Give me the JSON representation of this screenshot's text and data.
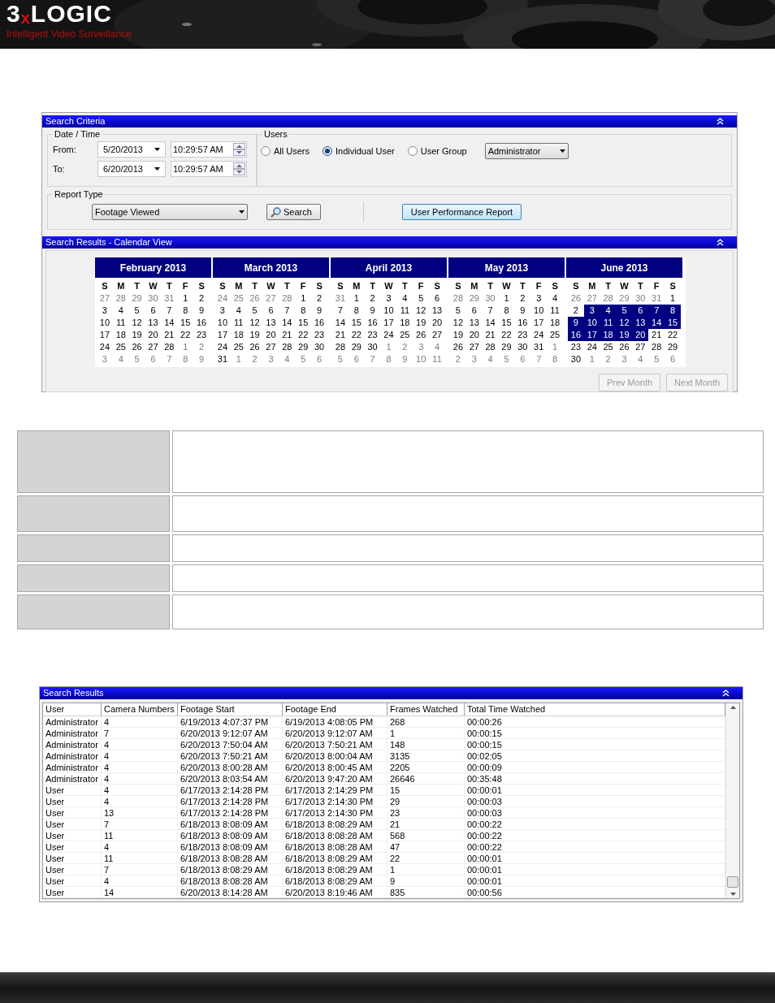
{
  "header": {
    "logo": [
      {
        "text": "3",
        "color": "#ffffff"
      },
      {
        "text": "x",
        "color": "#d01010"
      },
      {
        "text": "LOGIC",
        "color": "#ffffff"
      }
    ],
    "tagline": "Intelligent Video Surveillance"
  },
  "search_criteria": {
    "title": "Search Criteria",
    "date_time": {
      "legend": "Date / Time",
      "rows": [
        {
          "label": "From:",
          "date": "5/20/2013",
          "time": "10:29:57 AM"
        },
        {
          "label": "To:",
          "date": "6/20/2013",
          "time": "10:29:57 AM"
        }
      ]
    },
    "users": {
      "legend": "Users",
      "options": [
        {
          "label": "All Users",
          "selected": false
        },
        {
          "label": "Individual User",
          "selected": true
        },
        {
          "label": "User Group",
          "selected": false
        }
      ],
      "user_select": "Administrator"
    },
    "report_type": {
      "legend": "Report Type",
      "value": "Footage Viewed"
    },
    "search_button": "Search",
    "report_button": "User Performance Report"
  },
  "calendar_view": {
    "title": "Search Results - Calendar View",
    "months": [
      {
        "title": "February 2013",
        "weekdays": [
          "S",
          "M",
          "T",
          "W",
          "T",
          "F",
          "S"
        ],
        "weeks": [
          [
            {
              "day": "27",
              "muted": true,
              "selected": false
            },
            {
              "day": "28",
              "muted": true,
              "selected": false
            },
            {
              "day": "29",
              "muted": true,
              "selected": false
            },
            {
              "day": "30",
              "muted": true,
              "selected": false
            },
            {
              "day": "31",
              "muted": true,
              "selected": false
            },
            {
              "day": "1",
              "muted": false,
              "selected": false
            },
            {
              "day": "2",
              "muted": false,
              "selected": false
            }
          ],
          [
            {
              "day": "3",
              "muted": false,
              "selected": false
            },
            {
              "day": "4",
              "muted": false,
              "selected": false
            },
            {
              "day": "5",
              "muted": false,
              "selected": false
            },
            {
              "day": "6",
              "muted": false,
              "selected": false
            },
            {
              "day": "7",
              "muted": false,
              "selected": false
            },
            {
              "day": "8",
              "muted": false,
              "selected": false
            },
            {
              "day": "9",
              "muted": false,
              "selected": false
            }
          ],
          [
            {
              "day": "10",
              "muted": false,
              "selected": false
            },
            {
              "day": "11",
              "muted": false,
              "selected": false
            },
            {
              "day": "12",
              "muted": false,
              "selected": false
            },
            {
              "day": "13",
              "muted": false,
              "selected": false
            },
            {
              "day": "14",
              "muted": false,
              "selected": false
            },
            {
              "day": "15",
              "muted": false,
              "selected": false
            },
            {
              "day": "16",
              "muted": false,
              "selected": false
            }
          ],
          [
            {
              "day": "17",
              "muted": false,
              "selected": false
            },
            {
              "day": "18",
              "muted": false,
              "selected": false
            },
            {
              "day": "19",
              "muted": false,
              "selected": false
            },
            {
              "day": "20",
              "muted": false,
              "selected": false
            },
            {
              "day": "21",
              "muted": false,
              "selected": false
            },
            {
              "day": "22",
              "muted": false,
              "selected": false
            },
            {
              "day": "23",
              "muted": false,
              "selected": false
            }
          ],
          [
            {
              "day": "24",
              "muted": false,
              "selected": false
            },
            {
              "day": "25",
              "muted": false,
              "selected": false
            },
            {
              "day": "26",
              "muted": false,
              "selected": false
            },
            {
              "day": "27",
              "muted": false,
              "selected": false
            },
            {
              "day": "28",
              "muted": false,
              "selected": false
            },
            {
              "day": "1",
              "muted": true,
              "selected": false
            },
            {
              "day": "2",
              "muted": true,
              "selected": false
            }
          ],
          [
            {
              "day": "3",
              "muted": true,
              "selected": false
            },
            {
              "day": "4",
              "muted": true,
              "selected": false
            },
            {
              "day": "5",
              "muted": true,
              "selected": false
            },
            {
              "day": "6",
              "muted": true,
              "selected": false
            },
            {
              "day": "7",
              "muted": true,
              "selected": false
            },
            {
              "day": "8",
              "muted": true,
              "selected": false
            },
            {
              "day": "9",
              "muted": true,
              "selected": false
            }
          ]
        ]
      },
      {
        "title": "March 2013",
        "weekdays": [
          "S",
          "M",
          "T",
          "W",
          "T",
          "F",
          "S"
        ],
        "weeks": [
          [
            {
              "day": "24",
              "muted": true,
              "selected": false
            },
            {
              "day": "25",
              "muted": true,
              "selected": false
            },
            {
              "day": "26",
              "muted": true,
              "selected": false
            },
            {
              "day": "27",
              "muted": true,
              "selected": false
            },
            {
              "day": "28",
              "muted": true,
              "selected": false
            },
            {
              "day": "1",
              "muted": false,
              "selected": false
            },
            {
              "day": "2",
              "muted": false,
              "selected": false
            }
          ],
          [
            {
              "day": "3",
              "muted": false,
              "selected": false
            },
            {
              "day": "4",
              "muted": false,
              "selected": false
            },
            {
              "day": "5",
              "muted": false,
              "selected": false
            },
            {
              "day": "6",
              "muted": false,
              "selected": false
            },
            {
              "day": "7",
              "muted": false,
              "selected": false
            },
            {
              "day": "8",
              "muted": false,
              "selected": false
            },
            {
              "day": "9",
              "muted": false,
              "selected": false
            }
          ],
          [
            {
              "day": "10",
              "muted": false,
              "selected": false
            },
            {
              "day": "11",
              "muted": false,
              "selected": false
            },
            {
              "day": "12",
              "muted": false,
              "selected": false
            },
            {
              "day": "13",
              "muted": false,
              "selected": false
            },
            {
              "day": "14",
              "muted": false,
              "selected": false
            },
            {
              "day": "15",
              "muted": false,
              "selected": false
            },
            {
              "day": "16",
              "muted": false,
              "selected": false
            }
          ],
          [
            {
              "day": "17",
              "muted": false,
              "selected": false
            },
            {
              "day": "18",
              "muted": false,
              "selected": false
            },
            {
              "day": "19",
              "muted": false,
              "selected": false
            },
            {
              "day": "20",
              "muted": false,
              "selected": false
            },
            {
              "day": "21",
              "muted": false,
              "selected": false
            },
            {
              "day": "22",
              "muted": false,
              "selected": false
            },
            {
              "day": "23",
              "muted": false,
              "selected": false
            }
          ],
          [
            {
              "day": "24",
              "muted": false,
              "selected": false
            },
            {
              "day": "25",
              "muted": false,
              "selected": false
            },
            {
              "day": "26",
              "muted": false,
              "selected": false
            },
            {
              "day": "27",
              "muted": false,
              "selected": false
            },
            {
              "day": "28",
              "muted": false,
              "selected": false
            },
            {
              "day": "29",
              "muted": false,
              "selected": false
            },
            {
              "day": "30",
              "muted": false,
              "selected": false
            }
          ],
          [
            {
              "day": "31",
              "muted": false,
              "selected": false
            },
            {
              "day": "1",
              "muted": true,
              "selected": false
            },
            {
              "day": "2",
              "muted": true,
              "selected": false
            },
            {
              "day": "3",
              "muted": true,
              "selected": false
            },
            {
              "day": "4",
              "muted": true,
              "selected": false
            },
            {
              "day": "5",
              "muted": true,
              "selected": false
            },
            {
              "day": "6",
              "muted": true,
              "selected": false
            }
          ]
        ]
      },
      {
        "title": "April 2013",
        "weekdays": [
          "S",
          "M",
          "T",
          "W",
          "T",
          "F",
          "S"
        ],
        "weeks": [
          [
            {
              "day": "31",
              "muted": true,
              "selected": false
            },
            {
              "day": "1",
              "muted": false,
              "selected": false
            },
            {
              "day": "2",
              "muted": false,
              "selected": false
            },
            {
              "day": "3",
              "muted": false,
              "selected": false
            },
            {
              "day": "4",
              "muted": false,
              "selected": false
            },
            {
              "day": "5",
              "muted": false,
              "selected": false
            },
            {
              "day": "6",
              "muted": false,
              "selected": false
            }
          ],
          [
            {
              "day": "7",
              "muted": false,
              "selected": false
            },
            {
              "day": "8",
              "muted": false,
              "selected": false
            },
            {
              "day": "9",
              "muted": false,
              "selected": false
            },
            {
              "day": "10",
              "muted": false,
              "selected": false
            },
            {
              "day": "11",
              "muted": false,
              "selected": false
            },
            {
              "day": "12",
              "muted": false,
              "selected": false
            },
            {
              "day": "13",
              "muted": false,
              "selected": false
            }
          ],
          [
            {
              "day": "14",
              "muted": false,
              "selected": false
            },
            {
              "day": "15",
              "muted": false,
              "selected": false
            },
            {
              "day": "16",
              "muted": false,
              "selected": false
            },
            {
              "day": "17",
              "muted": false,
              "selected": false
            },
            {
              "day": "18",
              "muted": false,
              "selected": false
            },
            {
              "day": "19",
              "muted": false,
              "selected": false
            },
            {
              "day": "20",
              "muted": false,
              "selected": false
            }
          ],
          [
            {
              "day": "21",
              "muted": false,
              "selected": false
            },
            {
              "day": "22",
              "muted": false,
              "selected": false
            },
            {
              "day": "23",
              "muted": false,
              "selected": false
            },
            {
              "day": "24",
              "muted": false,
              "selected": false
            },
            {
              "day": "25",
              "muted": false,
              "selected": false
            },
            {
              "day": "26",
              "muted": false,
              "selected": false
            },
            {
              "day": "27",
              "muted": false,
              "selected": false
            }
          ],
          [
            {
              "day": "28",
              "muted": false,
              "selected": false
            },
            {
              "day": "29",
              "muted": false,
              "selected": false
            },
            {
              "day": "30",
              "muted": false,
              "selected": false
            },
            {
              "day": "1",
              "muted": true,
              "selected": false
            },
            {
              "day": "2",
              "muted": true,
              "selected": false
            },
            {
              "day": "3",
              "muted": true,
              "selected": false
            },
            {
              "day": "4",
              "muted": true,
              "selected": false
            }
          ],
          [
            {
              "day": "5",
              "muted": true,
              "selected": false
            },
            {
              "day": "6",
              "muted": true,
              "selected": false
            },
            {
              "day": "7",
              "muted": true,
              "selected": false
            },
            {
              "day": "8",
              "muted": true,
              "selected": false
            },
            {
              "day": "9",
              "muted": true,
              "selected": false
            },
            {
              "day": "10",
              "muted": true,
              "selected": false
            },
            {
              "day": "11",
              "muted": true,
              "selected": false
            }
          ]
        ]
      },
      {
        "title": "May 2013",
        "weekdays": [
          "S",
          "M",
          "T",
          "W",
          "T",
          "F",
          "S"
        ],
        "weeks": [
          [
            {
              "day": "28",
              "muted": true,
              "selected": false
            },
            {
              "day": "29",
              "muted": true,
              "selected": false
            },
            {
              "day": "30",
              "muted": true,
              "selected": false
            },
            {
              "day": "1",
              "muted": false,
              "selected": false
            },
            {
              "day": "2",
              "muted": false,
              "selected": false
            },
            {
              "day": "3",
              "muted": false,
              "selected": false
            },
            {
              "day": "4",
              "muted": false,
              "selected": false
            }
          ],
          [
            {
              "day": "5",
              "muted": false,
              "selected": false
            },
            {
              "day": "6",
              "muted": false,
              "selected": false
            },
            {
              "day": "7",
              "muted": false,
              "selected": false
            },
            {
              "day": "8",
              "muted": false,
              "selected": false
            },
            {
              "day": "9",
              "muted": false,
              "selected": false
            },
            {
              "day": "10",
              "muted": false,
              "selected": false
            },
            {
              "day": "11",
              "muted": false,
              "selected": false
            }
          ],
          [
            {
              "day": "12",
              "muted": false,
              "selected": false
            },
            {
              "day": "13",
              "muted": false,
              "selected": false
            },
            {
              "day": "14",
              "muted": false,
              "selected": false
            },
            {
              "day": "15",
              "muted": false,
              "selected": false
            },
            {
              "day": "16",
              "muted": false,
              "selected": false
            },
            {
              "day": "17",
              "muted": false,
              "selected": false
            },
            {
              "day": "18",
              "muted": false,
              "selected": false
            }
          ],
          [
            {
              "day": "19",
              "muted": false,
              "selected": false
            },
            {
              "day": "20",
              "muted": false,
              "selected": false
            },
            {
              "day": "21",
              "muted": false,
              "selected": false
            },
            {
              "day": "22",
              "muted": false,
              "selected": false
            },
            {
              "day": "23",
              "muted": false,
              "selected": false
            },
            {
              "day": "24",
              "muted": false,
              "selected": false
            },
            {
              "day": "25",
              "muted": false,
              "selected": false
            }
          ],
          [
            {
              "day": "26",
              "muted": false,
              "selected": false
            },
            {
              "day": "27",
              "muted": false,
              "selected": false
            },
            {
              "day": "28",
              "muted": false,
              "selected": false
            },
            {
              "day": "29",
              "muted": false,
              "selected": false
            },
            {
              "day": "30",
              "muted": false,
              "selected": false
            },
            {
              "day": "31",
              "muted": false,
              "selected": false
            },
            {
              "day": "1",
              "muted": true,
              "selected": false
            }
          ],
          [
            {
              "day": "2",
              "muted": true,
              "selected": false
            },
            {
              "day": "3",
              "muted": true,
              "selected": false
            },
            {
              "day": "4",
              "muted": true,
              "selected": false
            },
            {
              "day": "5",
              "muted": true,
              "selected": false
            },
            {
              "day": "6",
              "muted": true,
              "selected": false
            },
            {
              "day": "7",
              "muted": true,
              "selected": false
            },
            {
              "day": "8",
              "muted": true,
              "selected": false
            }
          ]
        ]
      },
      {
        "title": "June 2013",
        "weekdays": [
          "S",
          "M",
          "T",
          "W",
          "T",
          "F",
          "S"
        ],
        "weeks": [
          [
            {
              "day": "26",
              "muted": true,
              "selected": false
            },
            {
              "day": "27",
              "muted": true,
              "selected": false
            },
            {
              "day": "28",
              "muted": true,
              "selected": false
            },
            {
              "day": "29",
              "muted": true,
              "selected": false
            },
            {
              "day": "30",
              "muted": true,
              "selected": false
            },
            {
              "day": "31",
              "muted": true,
              "selected": false
            },
            {
              "day": "1",
              "muted": false,
              "selected": false
            }
          ],
          [
            {
              "day": "2",
              "muted": false,
              "selected": false
            },
            {
              "day": "3",
              "muted": false,
              "selected": true
            },
            {
              "day": "4",
              "muted": false,
              "selected": true
            },
            {
              "day": "5",
              "muted": false,
              "selected": true
            },
            {
              "day": "6",
              "muted": false,
              "selected": true
            },
            {
              "day": "7",
              "muted": false,
              "selected": true
            },
            {
              "day": "8",
              "muted": false,
              "selected": true
            }
          ],
          [
            {
              "day": "9",
              "muted": false,
              "selected": true
            },
            {
              "day": "10",
              "muted": false,
              "selected": true
            },
            {
              "day": "11",
              "muted": false,
              "selected": true
            },
            {
              "day": "12",
              "muted": false,
              "selected": true
            },
            {
              "day": "13",
              "muted": false,
              "selected": true
            },
            {
              "day": "14",
              "muted": false,
              "selected": true
            },
            {
              "day": "15",
              "muted": false,
              "selected": true
            }
          ],
          [
            {
              "day": "16",
              "muted": false,
              "selected": true
            },
            {
              "day": "17",
              "muted": false,
              "selected": true
            },
            {
              "day": "18",
              "muted": false,
              "selected": true
            },
            {
              "day": "19",
              "muted": false,
              "selected": true
            },
            {
              "day": "20",
              "muted": false,
              "selected": true
            },
            {
              "day": "21",
              "muted": false,
              "selected": false
            },
            {
              "day": "22",
              "muted": false,
              "selected": false
            }
          ],
          [
            {
              "day": "23",
              "muted": false,
              "selected": false
            },
            {
              "day": "24",
              "muted": false,
              "selected": false
            },
            {
              "day": "25",
              "muted": false,
              "selected": false
            },
            {
              "day": "26",
              "muted": false,
              "selected": false
            },
            {
              "day": "27",
              "muted": false,
              "selected": false
            },
            {
              "day": "28",
              "muted": false,
              "selected": false
            },
            {
              "day": "29",
              "muted": false,
              "selected": false
            }
          ],
          [
            {
              "day": "30",
              "muted": false,
              "selected": false
            },
            {
              "day": "1",
              "muted": true,
              "selected": false
            },
            {
              "day": "2",
              "muted": true,
              "selected": false
            },
            {
              "day": "3",
              "muted": true,
              "selected": false
            },
            {
              "day": "4",
              "muted": true,
              "selected": false
            },
            {
              "day": "5",
              "muted": true,
              "selected": false
            },
            {
              "day": "6",
              "muted": true,
              "selected": false
            }
          ]
        ]
      }
    ],
    "prev_button": {
      "label": "Prev Month",
      "disabled": true
    },
    "next_button": {
      "label": "Next Month",
      "disabled": true
    }
  },
  "results": {
    "title": "Search Results",
    "columns": [
      "User",
      "Camera Numbers",
      "Footage Start",
      "Footage End",
      "Frames Watched",
      "Total Time Watched"
    ],
    "rows": [
      [
        "Administrator",
        "4",
        "6/19/2013 4:07:37 PM",
        "6/19/2013 4:08:05 PM",
        "268",
        "00:00:26"
      ],
      [
        "Administrator",
        "7",
        "6/20/2013 9:12:07 AM",
        "6/20/2013 9:12:07 AM",
        "1",
        "00:00:15"
      ],
      [
        "Administrator",
        "4",
        "6/20/2013 7:50:04 AM",
        "6/20/2013 7:50:21 AM",
        "148",
        "00:00:15"
      ],
      [
        "Administrator",
        "4",
        "6/20/2013 7:50:21 AM",
        "6/20/2013 8:00:04 AM",
        "3135",
        "00:02:05"
      ],
      [
        "Administrator",
        "4",
        "6/20/2013 8:00:28 AM",
        "6/20/2013 8:00:45 AM",
        "2205",
        "00:00:09"
      ],
      [
        "Administrator",
        "4",
        "6/20/2013 8:03:54 AM",
        "6/20/2013 9:47:20 AM",
        "26646",
        "00:35:48"
      ],
      [
        "User",
        "4",
        "6/17/2013 2:14:28 PM",
        "6/17/2013 2:14:29 PM",
        "15",
        "00:00:01"
      ],
      [
        "User",
        "4",
        "6/17/2013 2:14:28 PM",
        "6/17/2013 2:14:30 PM",
        "29",
        "00:00:03"
      ],
      [
        "User",
        "13",
        "6/17/2013 2:14:28 PM",
        "6/17/2013 2:14:30 PM",
        "23",
        "00:00:03"
      ],
      [
        "User",
        "7",
        "6/18/2013 8:08:09 AM",
        "6/18/2013 8:08:29 AM",
        "21",
        "00:00:22"
      ],
      [
        "User",
        "11",
        "6/18/2013 8:08:09 AM",
        "6/18/2013 8:08:28 AM",
        "568",
        "00:00:22"
      ],
      [
        "User",
        "4",
        "6/18/2013 8:08:09 AM",
        "6/18/2013 8:08:28 AM",
        "47",
        "00:00:22"
      ],
      [
        "User",
        "11",
        "6/18/2013 8:08:28 AM",
        "6/18/2013 8:08:29 AM",
        "22",
        "00:00:01"
      ],
      [
        "User",
        "7",
        "6/18/2013 8:08:29 AM",
        "6/18/2013 8:08:29 AM",
        "1",
        "00:00:01"
      ],
      [
        "User",
        "4",
        "6/18/2013 8:08:28 AM",
        "6/18/2013 8:08:29 AM",
        "9",
        "00:00:01"
      ],
      [
        "User",
        "14",
        "6/20/2013 8:14:28 AM",
        "6/20/2013 8:19:46 AM",
        "835",
        "00:00:56"
      ]
    ]
  }
}
